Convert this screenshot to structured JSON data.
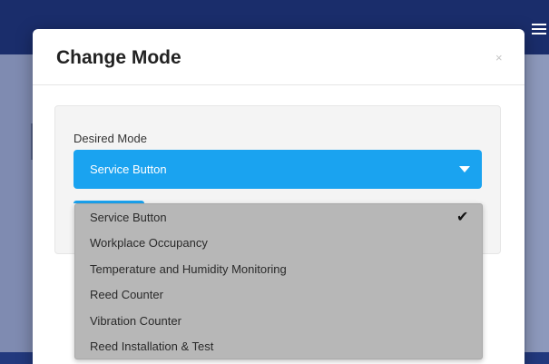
{
  "modal": {
    "title": "Change Mode",
    "close_glyph": "×"
  },
  "form": {
    "label": "Desired Mode",
    "selected_value": "Service Button"
  },
  "dropdown": {
    "options": [
      "Service Button",
      "Workplace Occupancy",
      "Temperature and Humidity Monitoring",
      "Reed Counter",
      "Vibration Counter",
      "Reed Installation & Test"
    ],
    "selected_index": 0,
    "check_glyph": "✔"
  },
  "colors": {
    "accent": "#1aa3f0",
    "header_bg": "#1a2d6b",
    "dropdown_bg": "#b7b7b7"
  }
}
